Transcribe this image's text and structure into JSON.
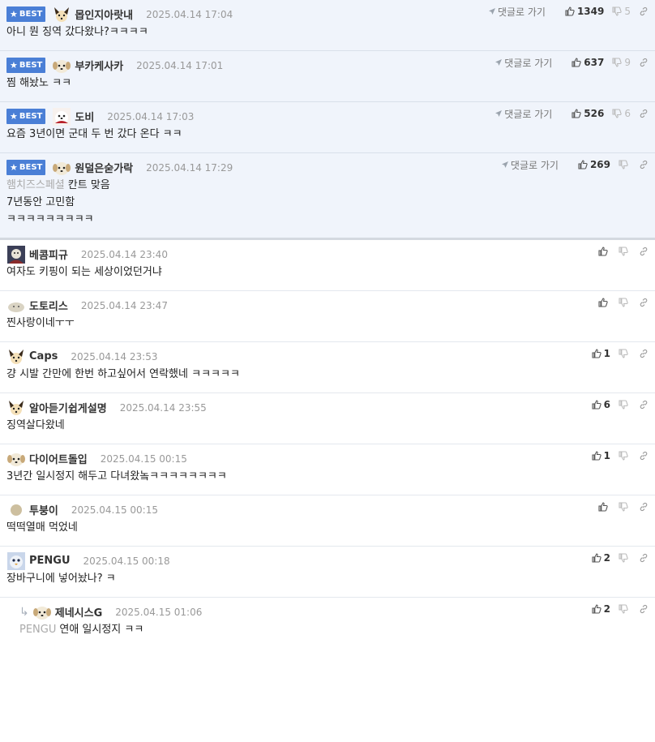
{
  "best_label": "BEST",
  "goto_label": "댓글로 가기",
  "best_comments": [
    {
      "nick": "몹인지아랏내",
      "date": "2025.04.14 17:04",
      "avatar": "fox-avatar",
      "up": "1349",
      "down": "5",
      "lines": [
        "아니 뭔 징역 갔다왔나?ㅋㅋㅋㅋ"
      ]
    },
    {
      "nick": "부카케사카",
      "date": "2025.04.14 17:01",
      "avatar": "puppy-avatar",
      "up": "637",
      "down": "9",
      "lines": [
        "찜 해놨노 ㅋㅋ"
      ]
    },
    {
      "nick": "도비",
      "date": "2025.04.14 17:03",
      "avatar": "dog-photo-avatar",
      "up": "526",
      "down": "6",
      "lines": [
        "요즘 3년이면 군대 두 번 갔다 온다 ㅋㅋ"
      ]
    },
    {
      "nick": "원덜은숟가락",
      "date": "2025.04.14 17:29",
      "avatar": "puppy-avatar",
      "up": "269",
      "down": "",
      "quote": "햄치즈스페셜",
      "lines": [
        "칸트 맞음",
        "7년동안 고민함",
        "ㅋㅋㅋㅋㅋㅋㅋㅋㅋ"
      ]
    }
  ],
  "comments": [
    {
      "nick": "베콤피규",
      "date": "2025.04.14 23:40",
      "avatar": "photo-avatar",
      "up": "",
      "down": "",
      "lines": [
        "여자도 키핑이 되는 세상이었던거냐"
      ]
    },
    {
      "nick": "도토리스",
      "date": "2025.04.14 23:47",
      "avatar": "blob-avatar",
      "up": "",
      "down": "",
      "lines": [
        "찐사랑이네ㅜㅜ"
      ]
    },
    {
      "nick": "Caps",
      "date": "2025.04.14 23:53",
      "avatar": "fox-avatar",
      "up": "1",
      "down": "",
      "lines": [
        "걍 시발 간만에 한번 하고싶어서 연락했네 ㅋㅋㅋㅋㅋ"
      ]
    },
    {
      "nick": "알아듣기쉽게설명",
      "date": "2025.04.14 23:55",
      "avatar": "fox-avatar",
      "up": "6",
      "down": "",
      "lines": [
        "징역살다왔네"
      ]
    },
    {
      "nick": "다이어트돌입",
      "date": "2025.04.15 00:15",
      "avatar": "puppy-avatar",
      "up": "1",
      "down": "",
      "lines": [
        "3년간 일시정지 해두고 다녀왔놐ㅋㅋㅋㅋㅋㅋㅋㅋ"
      ]
    },
    {
      "nick": "투붕이",
      "date": "2025.04.15 00:15",
      "avatar": "dot-avatar",
      "up": "",
      "down": "",
      "lines": [
        "떡떡열매 먹었네"
      ]
    },
    {
      "nick": "PENGU",
      "date": "2025.04.15 00:18",
      "avatar": "penguin-photo-avatar",
      "up": "2",
      "down": "",
      "lines": [
        "장바구니에 넣어놨나? ㅋ"
      ]
    },
    {
      "nick": "제네시스G",
      "date": "2025.04.15 01:06",
      "avatar": "puppy-avatar",
      "up": "2",
      "down": "",
      "reply": true,
      "quote": "PENGU",
      "lines": [
        "연애 일시정지 ㅋㅋ"
      ]
    }
  ]
}
